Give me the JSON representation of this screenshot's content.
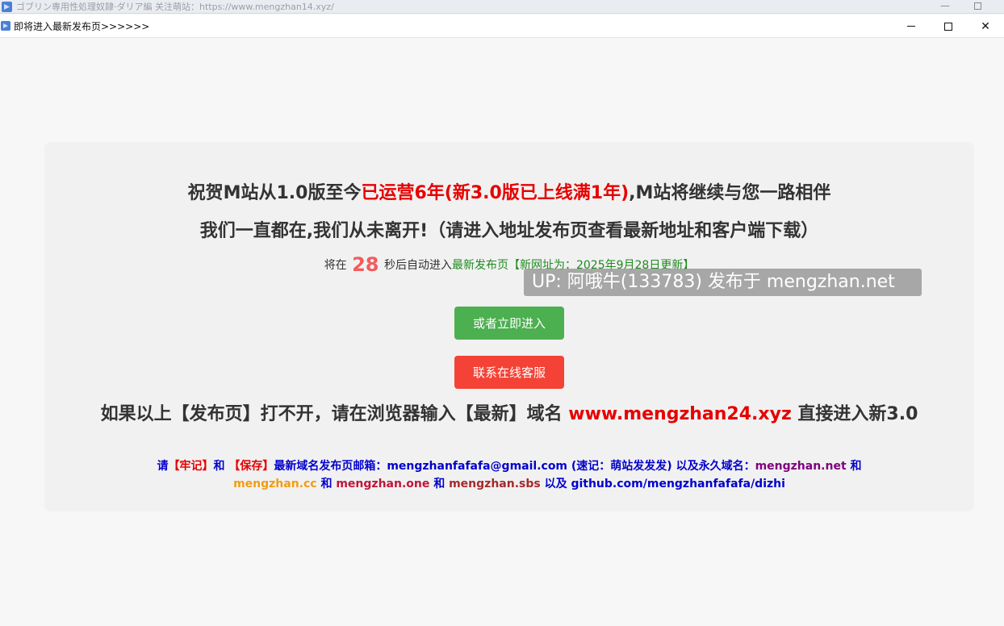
{
  "outer_window": {
    "title": "ゴブリン専用性処理奴隷·ダリア編 关注萌站：https://www.mengzhan14.xyz/",
    "minimize_glyph": "—",
    "maximize_glyph": ""
  },
  "inner_window": {
    "title": "即将进入最新发布页>>>>>>",
    "close_glyph": "✕"
  },
  "headline1": {
    "part1": "祝贺M站从1.0版至今",
    "part2_red": "已运营6年(新3.0版已上线满1年)",
    "part3": ",M站将继续与您一路相伴"
  },
  "headline2": "我们一直都在,我们从未离开!（请进入地址发布页查看最新地址和客户端下载）",
  "countdown": {
    "prefix": "将在",
    "seconds": "28",
    "suffix": "秒后自动进入",
    "link_text": "最新发布页【新网址为：2025年9月28日更新】"
  },
  "watermark": "UP: 阿哦牛(133783) 发布于 mengzhan.net",
  "buttons": {
    "enter_now": "或者立即进入",
    "customer_service": "联系在线客服"
  },
  "notice": {
    "part1": "如果以上【发布页】打不开，请在浏览器输入【最新】域名 ",
    "domain": "www.mengzhan24.xyz",
    "part2": " 直接进入新3.0"
  },
  "footer": {
    "t1": "请",
    "t2": "【牢记】",
    "t3": "和 ",
    "t4": "【保存】",
    "t5": "最新域名发布页邮箱：mengzhanfafafa@gmail.com (速记：萌站发发发) 以及永久域名：",
    "d1": "mengzhan.net",
    "t6": " 和 ",
    "d2": "mengzhan.cc",
    "t7": " 和 ",
    "d3": "mengzhan.one",
    "t8": " 和 ",
    "d4": "mengzhan.sbs",
    "t9": " 以及 github.com/mengzhanfafafa/dizhi"
  }
}
